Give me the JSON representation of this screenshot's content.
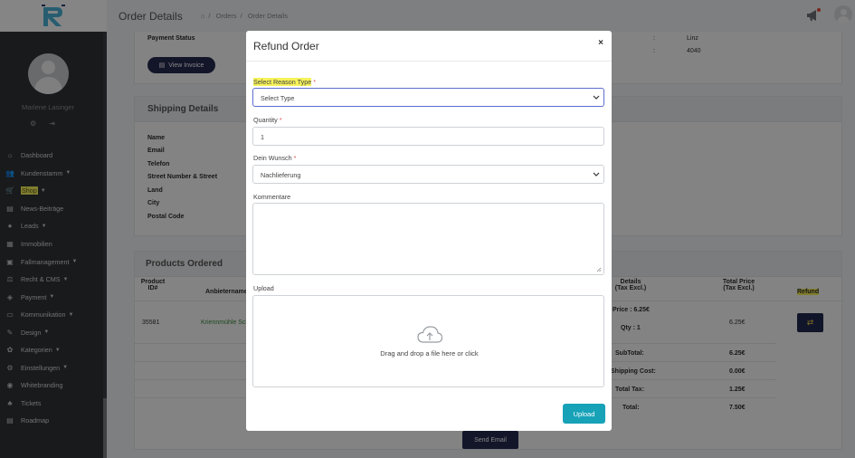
{
  "topbar": {
    "page_title": "Order Details",
    "breadcrumb": [
      "Orders",
      "Order Details"
    ]
  },
  "sidebar": {
    "user_name": "Marlene Lasinger",
    "items": [
      {
        "label": "Dashboard",
        "icon": "dashboard-icon",
        "caret": false
      },
      {
        "label": "Kundenstamm",
        "icon": "users-icon",
        "caret": true
      },
      {
        "label": "Shop",
        "icon": "cart-icon",
        "caret": true,
        "active": true
      },
      {
        "label": "News-Beiträge",
        "icon": "news-icon",
        "caret": false
      },
      {
        "label": "Leads",
        "icon": "leads-icon",
        "caret": true
      },
      {
        "label": "Immobilien",
        "icon": "building-icon",
        "caret": false
      },
      {
        "label": "Fallmanagement",
        "icon": "briefcase-icon",
        "caret": true
      },
      {
        "label": "Recht & CMS",
        "icon": "scale-icon",
        "caret": true
      },
      {
        "label": "Payment",
        "icon": "payment-icon",
        "caret": true
      },
      {
        "label": "Kommunikation",
        "icon": "chat-icon",
        "caret": true
      },
      {
        "label": "Design",
        "icon": "design-icon",
        "caret": true
      },
      {
        "label": "Kategorien",
        "icon": "tags-icon",
        "caret": true
      },
      {
        "label": "Einstellungen",
        "icon": "settings-icon",
        "caret": true
      },
      {
        "label": "Whitebranding",
        "icon": "globe-icon",
        "caret": false
      },
      {
        "label": "Tickets",
        "icon": "ticket-icon",
        "caret": false
      },
      {
        "label": "Roadmap",
        "icon": "roadmap-icon",
        "caret": false
      }
    ]
  },
  "background": {
    "payment_status_label": "Payment Status",
    "view_invoice_label": "View Invoice",
    "right_city": "Linz",
    "right_zip": "4040",
    "shipping_title": "Shipping Details",
    "shipping_fields": [
      "Name",
      "Email",
      "Telefon",
      "Street Number & Street",
      "Land",
      "City",
      "Postal Code"
    ],
    "products_title": "Products Ordered",
    "col_product_id_1": "Product",
    "col_product_id_2": "ID#",
    "col_anbieter": "Anbietername",
    "col_details_1": "Details",
    "col_details_2": "(Tax Excl.)",
    "col_total_1": "Total Price",
    "col_total_2": "(Tax Excl.)",
    "col_refund": "Refund",
    "row_id": "35581",
    "row_anbieter": "Kriennmühle Sch",
    "row_price": "Price : 6.25€",
    "row_qty": "Qty : 1",
    "row_total": "6.25€",
    "subtotal_label": "SubTotal:",
    "subtotal_value": "6.25€",
    "shipping_cost_label": "Shipping Cost:",
    "shipping_cost_value": "0.00€",
    "total_tax_label": "Total Tax:",
    "total_tax_value": "1.25€",
    "total_label": "Total:",
    "total_value": "7.50€",
    "send_email_label": "Send Email"
  },
  "modal": {
    "title": "Refund Order",
    "close": "×",
    "reason_label": "Select Reason Type",
    "reason_value": "Select Type",
    "quantity_label": "Quantity",
    "quantity_value": "1",
    "wunsch_label": "Dein Wunsch",
    "wunsch_value": "Nachlieferung",
    "kommentare_label": "Kommentare",
    "upload_label": "Upload",
    "dropzone_text": "Drag and drop a file here or click",
    "upload_button": "Upload",
    "required_mark": "*"
  }
}
